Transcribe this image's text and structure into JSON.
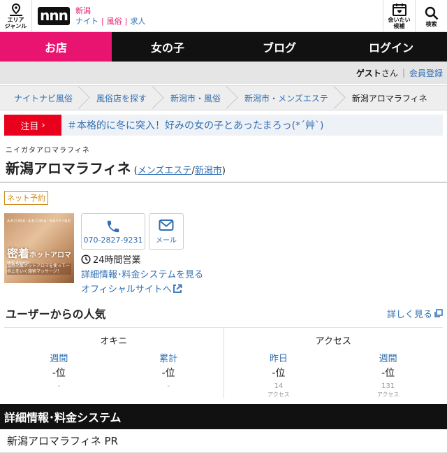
{
  "header": {
    "area_label_1": "エリア",
    "area_label_2": "ジャンル",
    "logo": "nnn",
    "prefecture": "新潟",
    "links": [
      "ナイト",
      "風俗",
      "求人"
    ],
    "meet_label_1": "会いたい",
    "meet_label_2": "候補",
    "search_label": "検索"
  },
  "nav": [
    "お店",
    "女の子",
    "ブログ",
    "ログイン"
  ],
  "guest": {
    "name": "ゲスト",
    "suffix": "さん",
    "register": "会員登録"
  },
  "breadcrumbs": [
    "ナイトナビ風俗",
    "風俗店を探す",
    "新潟市・風俗",
    "新潟市・メンズエステ",
    "新潟アロマラフィネ"
  ],
  "notice": {
    "tag": "注目",
    "message": "＃本格的に冬に突入！好みの女の子とあったまろっ(*´艸`)"
  },
  "shop": {
    "kana": "ニイガタアロマラフィネ",
    "name": "新潟アロマラフィネ",
    "category_open": "(",
    "category": "メンズエステ",
    "category_sep": "/",
    "city": "新潟市",
    "category_close": ")",
    "net_badge": "ネット予約",
    "phone": "070-2827-9231",
    "mail_label": "メール",
    "hours": "24時間営業",
    "details_link": "詳細情報･料金システムを見る",
    "official_link": "オフィシャルサイトへ",
    "thumb": {
      "top": "AROMA·AROMA·RAFFINE",
      "main": "密着",
      "main_small": "ホットアロマ",
      "sub": "Hot Aroma",
      "foot": "温感効果ホットアロマを使って一歩上をいく施術マッサージ！"
    }
  },
  "popularity": {
    "title": "ユーザーからの人気",
    "more": "詳しく見る",
    "groups": [
      {
        "name": "オキニ",
        "cols": [
          {
            "label": "週間",
            "value": "-位",
            "sub": "-",
            "sub2": ""
          },
          {
            "label": "累計",
            "value": "-位",
            "sub": "-",
            "sub2": ""
          }
        ]
      },
      {
        "name": "アクセス",
        "cols": [
          {
            "label": "昨日",
            "value": "-位",
            "sub": "14",
            "sub2": "アクセス"
          },
          {
            "label": "週間",
            "value": "-位",
            "sub": "131",
            "sub2": "アクセス"
          }
        ]
      }
    ]
  },
  "section_title": "詳細情報･料金システム",
  "pr_title": "新潟アロマラフィネ PR"
}
